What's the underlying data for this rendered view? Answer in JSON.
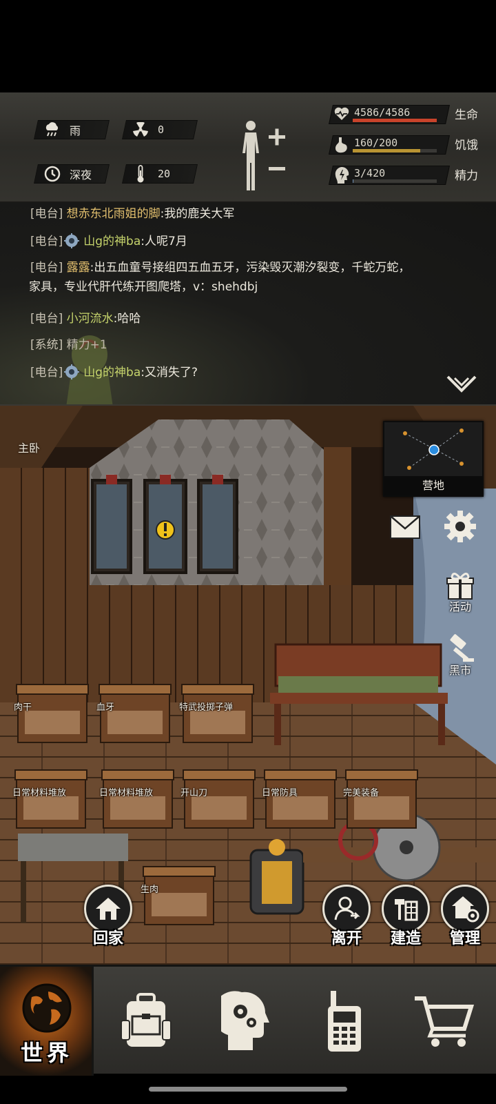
{
  "status": {
    "weather": {
      "icon": "rain-cloud-icon",
      "label": "雨"
    },
    "radiation": {
      "icon": "radiation-icon",
      "value": "0"
    },
    "time_of_day": {
      "icon": "clock-icon",
      "label": "深夜"
    },
    "temperature": {
      "icon": "thermometer-icon",
      "value": "20"
    },
    "vitals": [
      {
        "key": "health",
        "icon": "heartbeat-icon",
        "text": "4586/4586",
        "name": "生命",
        "fraction": 1.0,
        "color": "#c9432b"
      },
      {
        "key": "hunger",
        "icon": "stomach-icon",
        "text": "160/200",
        "name": "饥饿",
        "fraction": 0.8,
        "color": "#b99433"
      },
      {
        "key": "energy",
        "icon": "brain-bolt-icon",
        "text": "3/420",
        "name": "精力",
        "fraction": 0.007,
        "color": "#6e8fb4"
      }
    ]
  },
  "chat": {
    "messages": [
      {
        "channel": "[电台]",
        "name": "想赤东北雨姐的脚",
        "sep": ":",
        "text": "我的鹿关大军",
        "avatar": false,
        "name_color": "gold"
      },
      {
        "channel": "[电台]",
        "name": "山g的神ba",
        "sep": ":",
        "text": "人呢7月",
        "avatar": true,
        "name_color": "green"
      },
      {
        "channel": "[电台]",
        "name": "露露",
        "sep": ":",
        "text": "出五血童号接组四五血五牙，污染毁灭潮汐裂变，千蛇万蛇，",
        "text2": "家具，专业代肝代练开图爬塔，v：shehdbj",
        "avatar": false,
        "name_color": "gold"
      },
      {
        "channel": "[电台]",
        "name": "小河流水",
        "sep": ":",
        "text": "哈哈",
        "avatar": false,
        "name_color": "green"
      },
      {
        "channel": "[系统]",
        "name": "",
        "sep": "",
        "text": "精力+1",
        "avatar": false,
        "name_color": "system"
      },
      {
        "channel": "[电台]",
        "name": "山g的神ba",
        "sep": ":",
        "text": "又消失了?",
        "avatar": true,
        "name_color": "green"
      }
    ]
  },
  "room": {
    "name": "主卧",
    "minimap_label": "营地",
    "side_buttons": {
      "activity": "活动",
      "black_market": "黑市"
    },
    "chests": [
      "肉干",
      "血牙",
      "特武投掷子弹",
      "日常材料堆放",
      "日常材料堆放",
      "开山刀",
      "日常防具",
      "完美装备",
      "生肉"
    ],
    "actions": {
      "home": "回家",
      "leave": "离开",
      "build": "建造",
      "manage": "管理"
    }
  },
  "nav": {
    "world": "世界",
    "tabs": [
      "backpack-icon",
      "head-gears-icon",
      "radio-icon",
      "cart-icon"
    ]
  }
}
